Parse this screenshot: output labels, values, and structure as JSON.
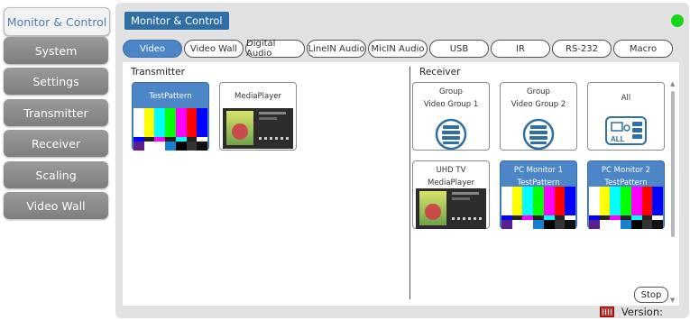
{
  "sidebar": {
    "items": [
      {
        "label": "Monitor & Control",
        "active": true
      },
      {
        "label": "System"
      },
      {
        "label": "Settings"
      },
      {
        "label": "Transmitter"
      },
      {
        "label": "Receiver"
      },
      {
        "label": "Scaling"
      },
      {
        "label": "Video Wall"
      }
    ]
  },
  "header": {
    "title": "Monitor & Control",
    "status_color": "#19d619"
  },
  "tabs": [
    "Video",
    "Video Wall",
    "Digital Audio",
    "LineIN Audio",
    "MicIN Audio",
    "USB",
    "IR",
    "RS-232",
    "Macro"
  ],
  "active_tab": "Video",
  "transmitter": {
    "title": "Transmitter",
    "tiles": [
      {
        "label": "TestPattern",
        "thumb": "test-pattern"
      },
      {
        "label": "MediaPlayer",
        "thumb": "media-player"
      }
    ]
  },
  "receiver": {
    "title": "Receiver",
    "tiles": [
      {
        "line1": "Group",
        "line2": "Video Group 1",
        "icon": "group-icon"
      },
      {
        "line1": "Group",
        "line2": "Video Group 2",
        "icon": "group-icon"
      },
      {
        "line1": "All",
        "line2": "",
        "icon": "all-devices-icon"
      },
      {
        "line1": "UHD TV",
        "line2": "MediaPlayer",
        "thumb": "media-player"
      },
      {
        "line1": "PC Monitor 1",
        "line2": "TestPattern",
        "thumb": "test-pattern"
      },
      {
        "line1": "PC Monitor 2",
        "line2": "TestPattern",
        "thumb": "test-pattern"
      }
    ]
  },
  "stop_label": "Stop",
  "footer": {
    "version_label": "Version:"
  },
  "colors": {
    "accent": "#4d86c6",
    "nav_gray": "#8c8c8c",
    "status": "#19d619"
  }
}
